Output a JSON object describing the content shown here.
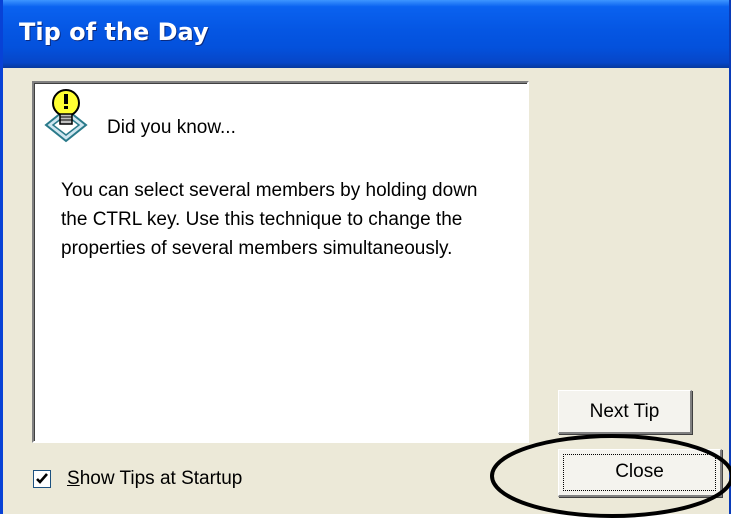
{
  "window": {
    "title": "Tip of the Day"
  },
  "tip": {
    "heading": "Did you know...",
    "body": "You can select several members by holding down the CTRL key. Use this technique to change the properties of several members simultaneously.",
    "icon": "lightbulb-icon"
  },
  "buttons": {
    "next_label": "Next Tip",
    "close_label": "Close"
  },
  "startup": {
    "checkbox_checked": true,
    "label_first": "S",
    "label_rest": "how Tips at Startup"
  },
  "colors": {
    "title_bar": "#0556e3",
    "dialog_face": "#ece9d8",
    "annotation": "#000000"
  }
}
